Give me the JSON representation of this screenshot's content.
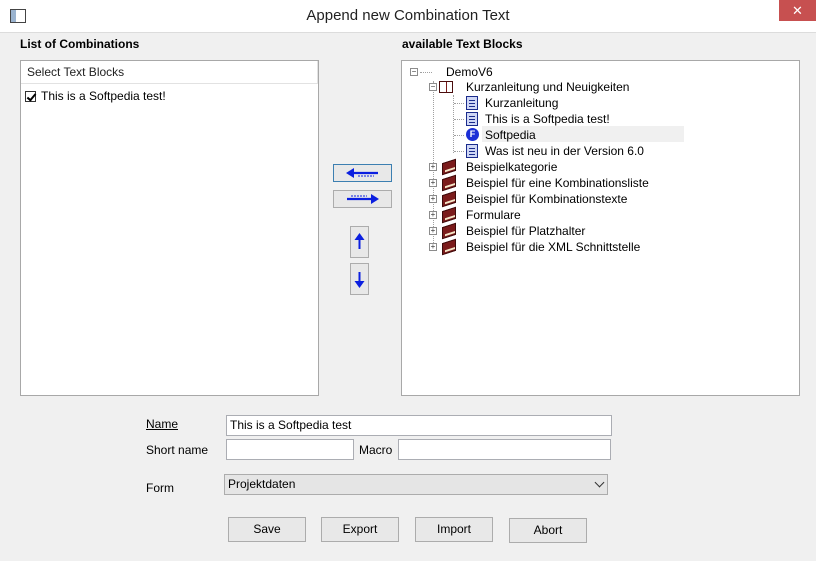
{
  "window": {
    "title": "Append new Combination Text",
    "close_symbol": "✕"
  },
  "left_panel": {
    "label": "List of Combinations",
    "header": "Select Text Blocks",
    "items": [
      {
        "label": "This is a Softpedia test!",
        "checked": true
      }
    ]
  },
  "right_panel": {
    "label": "available Text Blocks",
    "root": "DemoV6",
    "group_open": "Kurzanleitung und Neuigkeiten",
    "children": [
      "Kurzanleitung",
      "This is a Softpedia test!",
      "Softpedia",
      "Was ist neu in der Version 6.0"
    ],
    "f_icon_letter": "F",
    "groups": [
      "Beispielkategorie",
      "Beispiel für eine Kombinationsliste",
      "Beispiel für Kombinationstexte",
      "Formulare",
      "Beispiel für Platzhalter",
      "Beispiel für die XML Schnittstelle"
    ]
  },
  "form": {
    "name_label": "Name",
    "name_value": "This is a Softpedia test",
    "short_name_label": "Short name",
    "short_name_value": "",
    "macro_label": "Macro",
    "macro_value": "",
    "form_label": "Form",
    "form_value": "Projektdaten"
  },
  "buttons": {
    "save": "Save",
    "export": "Export",
    "import": "Import",
    "abort": "Abort"
  },
  "colors": {
    "arrow_blue": "#0b1fe0",
    "close_red": "#c75050",
    "book_red": "#7b1b1b"
  }
}
